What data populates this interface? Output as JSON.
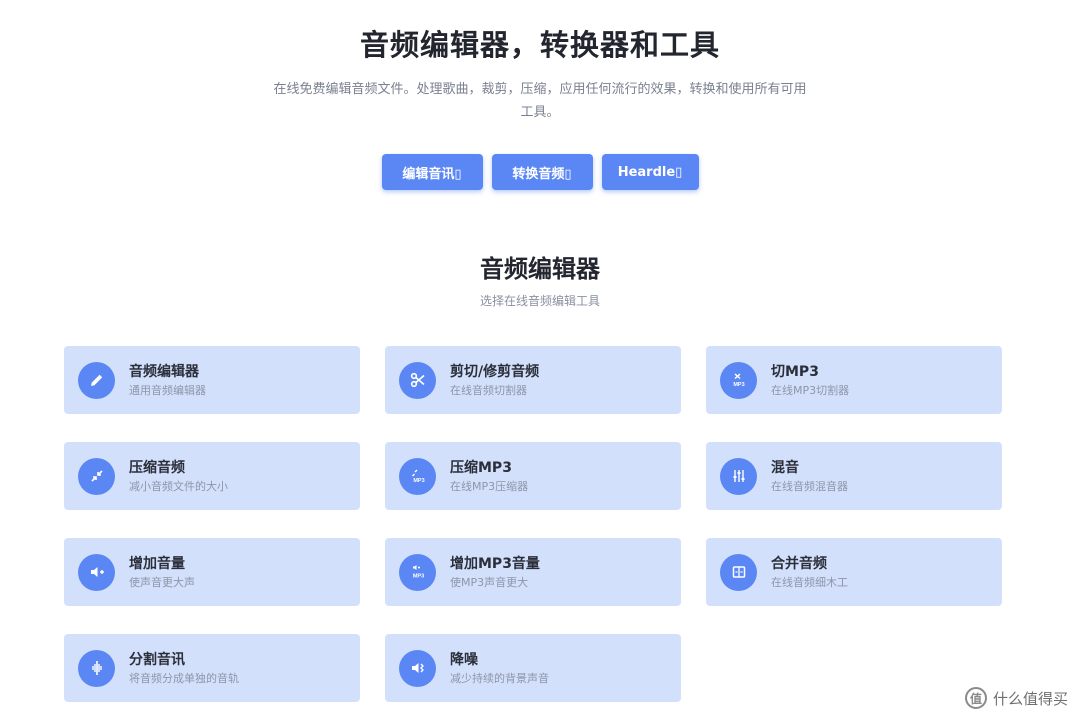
{
  "hero": {
    "title": "音频编辑器，转换器和工具",
    "description": "在线免费编辑音频文件。处理歌曲，裁剪，压缩，应用任何流行的效果，转换和使用所有可用工具。"
  },
  "buttons": [
    {
      "label": "编辑音讯▯"
    },
    {
      "label": "转换音频▯"
    },
    {
      "label": "Heardle▯"
    }
  ],
  "section": {
    "title": "音频编辑器",
    "subtitle": "选择在线音频编辑工具"
  },
  "tools": [
    {
      "title": "音频编辑器",
      "subtitle": "通用音频编辑器",
      "icon": "pencil-icon"
    },
    {
      "title": "剪切/修剪音频",
      "subtitle": "在线音频切割器",
      "icon": "scissors-icon"
    },
    {
      "title": "切MP3",
      "subtitle": "在线MP3切割器",
      "icon": "mp3-cut-icon"
    },
    {
      "title": "压缩音频",
      "subtitle": "减小音频文件的大小",
      "icon": "compress-icon"
    },
    {
      "title": "压缩MP3",
      "subtitle": "在线MP3压缩器",
      "icon": "mp3-compress-icon"
    },
    {
      "title": "混音",
      "subtitle": "在线音频混音器",
      "icon": "mixer-icon"
    },
    {
      "title": "增加音量",
      "subtitle": "使声音更大声",
      "icon": "volume-up-icon"
    },
    {
      "title": "增加MP3音量",
      "subtitle": "使MP3声音更大",
      "icon": "mp3-volume-icon"
    },
    {
      "title": "合并音频",
      "subtitle": "在线音频细木工",
      "icon": "merge-icon"
    },
    {
      "title": "分割音讯",
      "subtitle": "将音频分成单独的音轨",
      "icon": "split-icon"
    },
    {
      "title": "降噪",
      "subtitle": "减少持续的背景声音",
      "icon": "noise-reduction-icon"
    }
  ],
  "watermark": {
    "logo": "值",
    "text": "什么值得买"
  },
  "colors": {
    "accent": "#5b87f5",
    "card": "#d3e0fc"
  }
}
